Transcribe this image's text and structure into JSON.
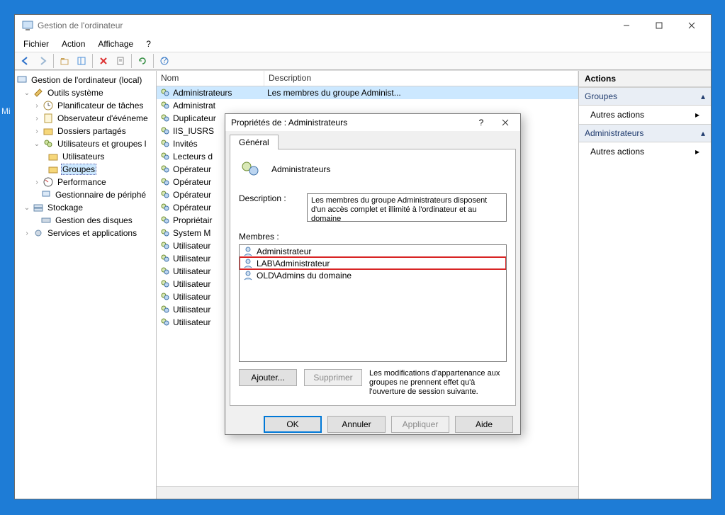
{
  "desktop": {
    "mi_label": "Mi"
  },
  "window": {
    "title": "Gestion de l'ordinateur",
    "menubar": [
      "Fichier",
      "Action",
      "Affichage",
      "?"
    ],
    "tree": {
      "root": "Gestion de l'ordinateur (local)",
      "system_tools": "Outils système",
      "task_scheduler": "Planificateur de tâches",
      "event_viewer": "Observateur d'événeme",
      "shared_folders": "Dossiers partagés",
      "users_groups": "Utilisateurs et groupes l",
      "users": "Utilisateurs",
      "groups": "Groupes",
      "performance": "Performance",
      "device_mgr": "Gestionnaire de périphé",
      "storage": "Stockage",
      "disk_mgmt": "Gestion des disques",
      "services_apps": "Services et applications"
    },
    "list": {
      "col_name": "Nom",
      "col_desc": "Description",
      "rows": [
        {
          "name": "Administrateurs",
          "desc": "Les membres du groupe Administ..."
        },
        {
          "name": "Administrat"
        },
        {
          "name": "Duplicateur"
        },
        {
          "name": "IIS_IUSRS"
        },
        {
          "name": "Invités"
        },
        {
          "name": "Lecteurs d"
        },
        {
          "name": "Opérateur"
        },
        {
          "name": "Opérateur"
        },
        {
          "name": "Opérateur"
        },
        {
          "name": "Opérateur"
        },
        {
          "name": "Propriétair"
        },
        {
          "name": "System M"
        },
        {
          "name": "Utilisateur"
        },
        {
          "name": "Utilisateur"
        },
        {
          "name": "Utilisateur"
        },
        {
          "name": "Utilisateur"
        },
        {
          "name": "Utilisateur"
        },
        {
          "name": "Utilisateur"
        },
        {
          "name": "Utilisateur"
        }
      ]
    },
    "actions": {
      "title": "Actions",
      "group1": "Groupes",
      "group2": "Administrateurs",
      "link": "Autres actions"
    }
  },
  "dialog": {
    "title": "Propriétés de : Administrateurs",
    "tab_general": "Général",
    "group_name": "Administrateurs",
    "desc_label": "Description :",
    "desc_text": "Les membres du groupe Administrateurs disposent d'un accès complet et illimité à l'ordinateur et au domaine",
    "members_label": "Membres :",
    "members": [
      "Administrateur",
      "LAB\\Administrateur",
      "OLD\\Admins du domaine"
    ],
    "add_btn": "Ajouter...",
    "remove_btn": "Supprimer",
    "note": "Les modifications d'appartenance aux groupes ne prennent effet qu'à l'ouverture de session suivante.",
    "ok": "OK",
    "cancel": "Annuler",
    "apply": "Appliquer",
    "help": "Aide"
  }
}
